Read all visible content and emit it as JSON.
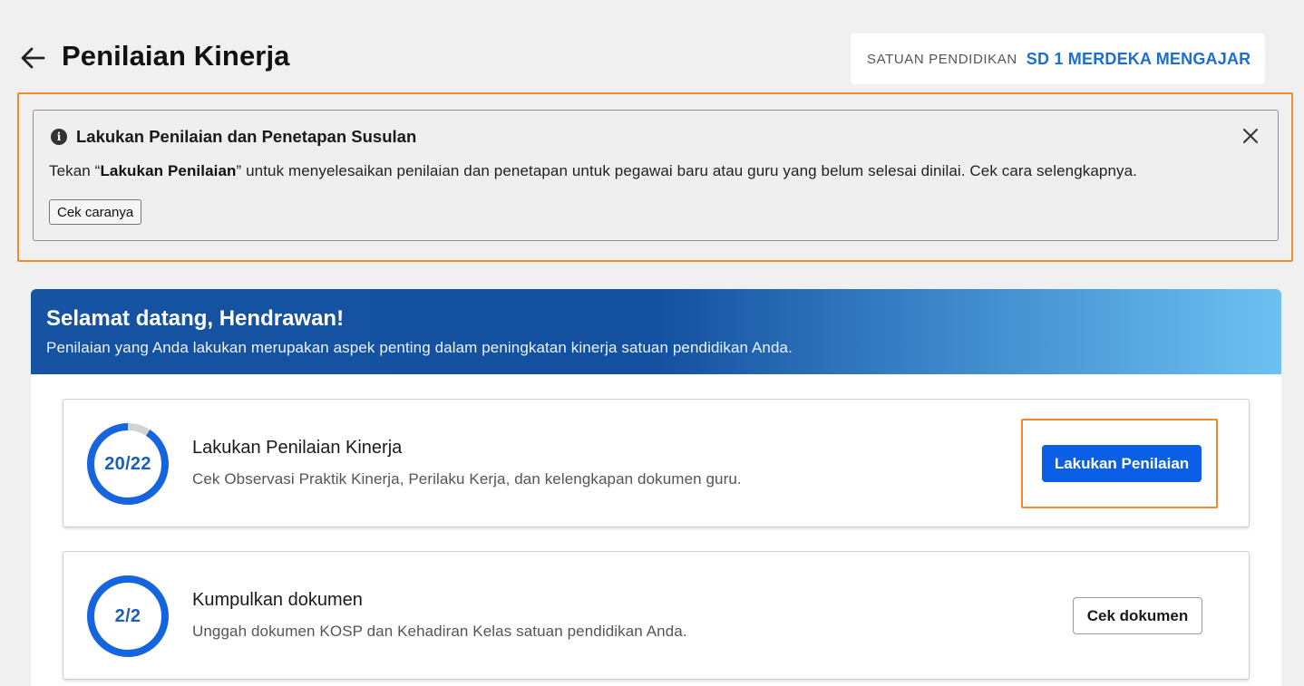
{
  "header": {
    "title": "Penilaian Kinerja",
    "back_icon": "arrow-left-icon",
    "school_label": "SATUAN PENDIDIKAN",
    "school_name": "SD 1 MERDEKA MENGAJAR"
  },
  "info_banner": {
    "icon": "info-icon",
    "title": "Lakukan Penilaian dan Penetapan Susulan",
    "text_before": "Tekan “",
    "text_bold": "Lakukan Penilaian",
    "text_after": "” untuk menyelesaikan penilaian dan penetapan untuk pegawai baru atau guru yang belum selesai dinilai. Cek cara selengkapnya.",
    "button_label": "Cek caranya",
    "close_icon": "close-icon"
  },
  "welcome": {
    "title": "Selamat datang, Hendrawan!",
    "subtitle": "Penilaian yang Anda lakukan merupakan aspek penting dalam peningkatan kinerja satuan pendidikan Anda."
  },
  "tasks": [
    {
      "progress_label": "20/22",
      "completed": 20,
      "total": 22,
      "title": "Lakukan Penilaian Kinerja",
      "description": "Cek Observasi Praktik Kinerja, Perilaku Kerja, dan kelengkapan dokumen guru.",
      "button_label": "Lakukan Penilaian"
    },
    {
      "progress_label": "2/2",
      "completed": 2,
      "total": 2,
      "title": "Kumpulkan dokumen",
      "description": "Unggah dokumen KOSP dan Kehadiran Kelas satuan pendidikan Anda.",
      "button_label": "Cek dokumen"
    }
  ],
  "colors": {
    "accent": "#0b5ee6",
    "ring_progress": "#1565e0",
    "ring_track": "#d3d3d3",
    "highlight": "#f08a2c"
  }
}
